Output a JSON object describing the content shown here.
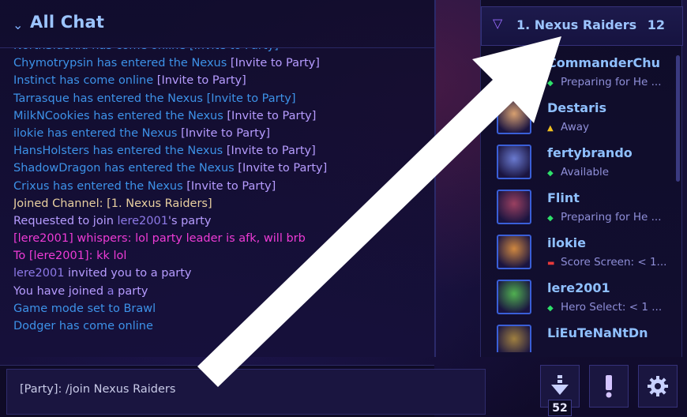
{
  "chat": {
    "title": "All Chat",
    "messages": [
      [
        {
          "t": "NorthSideKid has come online [Invite to Party]",
          "c": "c-blue"
        }
      ],
      [
        {
          "t": "Chymotrypsin",
          "c": "c-blue"
        },
        {
          "t": " has entered the Nexus ",
          "c": "c-blue"
        },
        {
          "t": "[Invite to Party]",
          "c": "c-linkp"
        }
      ],
      [
        {
          "t": "Instinct",
          "c": "c-blue"
        },
        {
          "t": " has come online ",
          "c": "c-blue"
        },
        {
          "t": "[Invite to Party]",
          "c": "c-linkp"
        }
      ],
      [
        {
          "t": "Tarrasque",
          "c": "c-blue"
        },
        {
          "t": " has entered the Nexus ",
          "c": "c-blue"
        },
        {
          "t": "[Invite to Party]",
          "c": "c-blue"
        }
      ],
      [
        {
          "t": "MilkNCookies",
          "c": "c-blue"
        },
        {
          "t": " has entered the Nexus ",
          "c": "c-blue"
        },
        {
          "t": "[Invite to Party]",
          "c": "c-linkp"
        }
      ],
      [
        {
          "t": "ilokie",
          "c": "c-blue"
        },
        {
          "t": " has entered the Nexus ",
          "c": "c-blue"
        },
        {
          "t": "[Invite to Party]",
          "c": "c-linkp"
        }
      ],
      [
        {
          "t": "HansHolsters",
          "c": "c-blue"
        },
        {
          "t": " has entered the Nexus ",
          "c": "c-blue"
        },
        {
          "t": "[Invite to Party]",
          "c": "c-linkp"
        }
      ],
      [
        {
          "t": "ShadowDragon",
          "c": "c-blue"
        },
        {
          "t": " has entered the Nexus ",
          "c": "c-blue"
        },
        {
          "t": "[Invite to Party]",
          "c": "c-linkp"
        }
      ],
      [
        {
          "t": "Crixus",
          "c": "c-blue"
        },
        {
          "t": " has entered the Nexus ",
          "c": "c-blue"
        },
        {
          "t": "[Invite to Party]",
          "c": "c-linkp"
        }
      ],
      [
        {
          "t": "Joined Channel: [1. Nexus Raiders]",
          "c": "c-yellow"
        }
      ],
      [
        {
          "t": "Requested to join ",
          "c": "c-purple"
        },
        {
          "t": "lere2001",
          "c": "c-purple-d"
        },
        {
          "t": "'s party",
          "c": "c-purple"
        }
      ],
      [
        {
          "t": "[lere2001] whispers: ",
          "c": "c-pink"
        },
        {
          "t": "lol party leader is afk, will brb",
          "c": "c-pink"
        }
      ],
      [
        {
          "t": "To [lere2001]: kk lol",
          "c": "c-pink"
        }
      ],
      [
        {
          "t": "lere2001",
          "c": "c-purple-d"
        },
        {
          "t": " invited you to a party",
          "c": "c-purple"
        }
      ],
      [
        {
          "t": "You have joined ",
          "c": "c-purple"
        },
        {
          "t": "a",
          "c": "c-purple-d"
        },
        {
          "t": " party",
          "c": "c-purple"
        }
      ],
      [
        {
          "t": "Game mode set to Brawl",
          "c": "c-blue"
        }
      ],
      [
        {
          "t": "Dodger",
          "c": "c-blue"
        },
        {
          "t": " has come online",
          "c": "c-blue"
        }
      ]
    ],
    "input_value": "[Party]: /join Nexus Raiders"
  },
  "friends": {
    "group_name": "1. Nexus Raiders",
    "group_count": "12",
    "items": [
      {
        "name": "CommanderChu",
        "status": "Preparing for He ...",
        "status_icon": "diamond-icon",
        "status_color": "#2ee06a",
        "avatar_color": "#4a6bd0"
      },
      {
        "name": "Destaris",
        "status": "Away",
        "status_icon": "triangle-icon",
        "status_color": "#f0c020",
        "avatar_color": "#d8a070"
      },
      {
        "name": "fertybrando",
        "status": "Available",
        "status_icon": "diamond-icon",
        "status_color": "#2ee06a",
        "avatar_color": "#6a7ad0"
      },
      {
        "name": "Flint",
        "status": "Preparing for He ...",
        "status_icon": "diamond-icon",
        "status_color": "#2ee06a",
        "avatar_color": "#9a4060"
      },
      {
        "name": "ilokie",
        "status": "Score Screen: < 1...",
        "status_icon": "dash-icon",
        "status_color": "#e83a3a",
        "avatar_color": "#d08840"
      },
      {
        "name": "lere2001",
        "status": "Hero Select: < 1 ...",
        "status_icon": "diamond-icon",
        "status_color": "#2ee06a",
        "avatar_color": "#50b050"
      },
      {
        "name": "LiEuTeNaNtDn",
        "status": "",
        "status_icon": "",
        "status_color": "#2ee06a",
        "avatar_color": "#a08040"
      }
    ]
  },
  "buttons": {
    "queue_count": "52",
    "items": [
      "download-queue-icon",
      "alert-icon",
      "settings-gear-icon"
    ]
  },
  "colors": {
    "arrow": "#ffffff",
    "accent": "#9cc4ff"
  }
}
